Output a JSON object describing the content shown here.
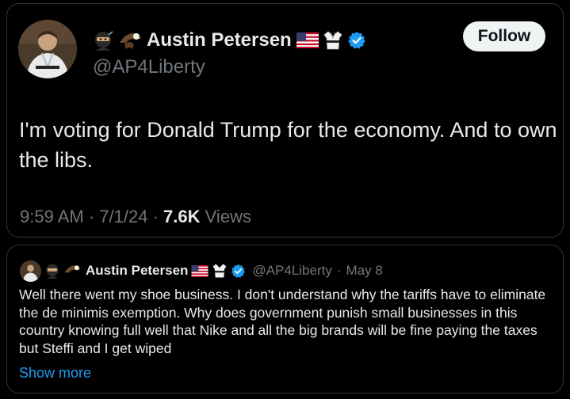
{
  "tweet": {
    "author_name": "Austin Petersen",
    "handle": "@AP4Liberty",
    "follow_label": "Follow",
    "text": "I'm voting for Donald Trump for the economy. And to own the libs.",
    "time": "9:59 AM",
    "date": "7/1/24",
    "views_count": "7.6K",
    "views_label": "Views"
  },
  "quote": {
    "author_name": "Austin Petersen",
    "handle": "@AP4Liberty",
    "date": "May 8",
    "text": "Well there went my shoe business. I don't understand why the tariffs have to eliminate the de minimis exemption. Why does government punish small businesses in this country knowing full well that Nike and all the big brands will be fine paying the taxes but Steffi and I get wiped",
    "show_more_label": "Show more"
  },
  "icons": [
    "avatar",
    "ninja-emoji-icon",
    "eagle-emoji-icon",
    "us-flag-icon",
    "karate-gi-icon",
    "verified-badge-icon"
  ],
  "colors": {
    "background": "#000000",
    "text": "#e7e9ea",
    "muted": "#71767b",
    "link": "#1d9bf0",
    "verified": "#1d9bf0",
    "follow_bg": "#eff3f4"
  }
}
